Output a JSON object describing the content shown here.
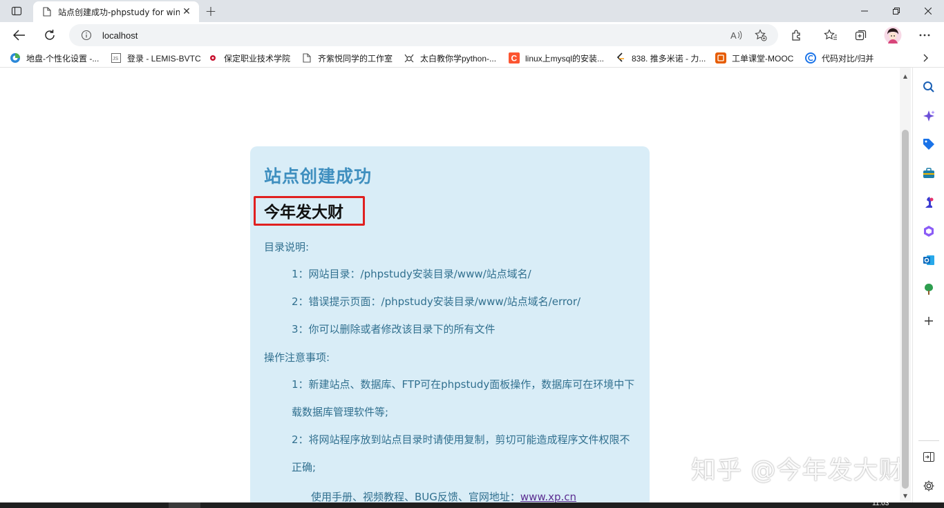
{
  "browser": {
    "tab": {
      "title": "站点创建成功-phpstudy for windows",
      "close": "✕"
    },
    "new_tab": "+",
    "window_controls": {
      "minimize": "—",
      "restore": "❐",
      "close": "✕"
    },
    "address": {
      "url": "localhost"
    }
  },
  "bookmarks": [
    {
      "label": "地盘-个性化设置 -...",
      "icon": "colorful-circle-icon",
      "color": "#2b88d8"
    },
    {
      "label": "登录 - LEMIS-BVTC",
      "icon": "js-page-icon",
      "color": "#666666"
    },
    {
      "label": "保定职业技术学院",
      "icon": "red-dot-icon",
      "color": "#c8102e"
    },
    {
      "label": "齐紫悦同学的工作室",
      "icon": "document-icon",
      "color": "#666666"
    },
    {
      "label": "太白教你学python-...",
      "icon": "spider-icon",
      "color": "#333333"
    },
    {
      "label": "linux上mysql的安装...",
      "icon": "csdn-c-icon",
      "color": "#fc5531"
    },
    {
      "label": "838. 推多米诺 - 力...",
      "icon": "leetcode-icon",
      "color": "#f89f1b"
    },
    {
      "label": "工单课堂-MOOC",
      "icon": "mooc-icon",
      "color": "#e65c00"
    },
    {
      "label": "代码对比/归并",
      "icon": "c-circle-icon",
      "color": "#1a73e8"
    }
  ],
  "page": {
    "heading": "站点创建成功",
    "subheading": "今年发大财",
    "dir_title": "目录说明:",
    "dir_items": [
      "1：网站目录：/phpstudy安装目录/www/站点域名/",
      "2：错误提示页面：/phpstudy安装目录/www/站点域名/error/",
      "3：你可以删除或者修改该目录下的所有文件"
    ],
    "notes_title": "操作注意事项:",
    "notes_items": [
      "1：新建站点、数据库、FTP可在phpstudy面板操作，数据库可在环境中下载数据库管理软件等;",
      "2：将网站程序放到站点目录时请使用复制，剪切可能造成程序文件权限不正确;"
    ],
    "links_prefix": "使用手册、视频教程、BUG反馈、官网地址：",
    "site_link": "www.xp.cn"
  },
  "watermark": "知乎 @今年发大财",
  "taskbar": {
    "clock": "11:03"
  },
  "colors": {
    "card_bg": "#d9edf7",
    "card_text": "#31708f",
    "heading": "#3f8fbf",
    "highlight_border": "#e02020",
    "link": "#5b2d91"
  }
}
